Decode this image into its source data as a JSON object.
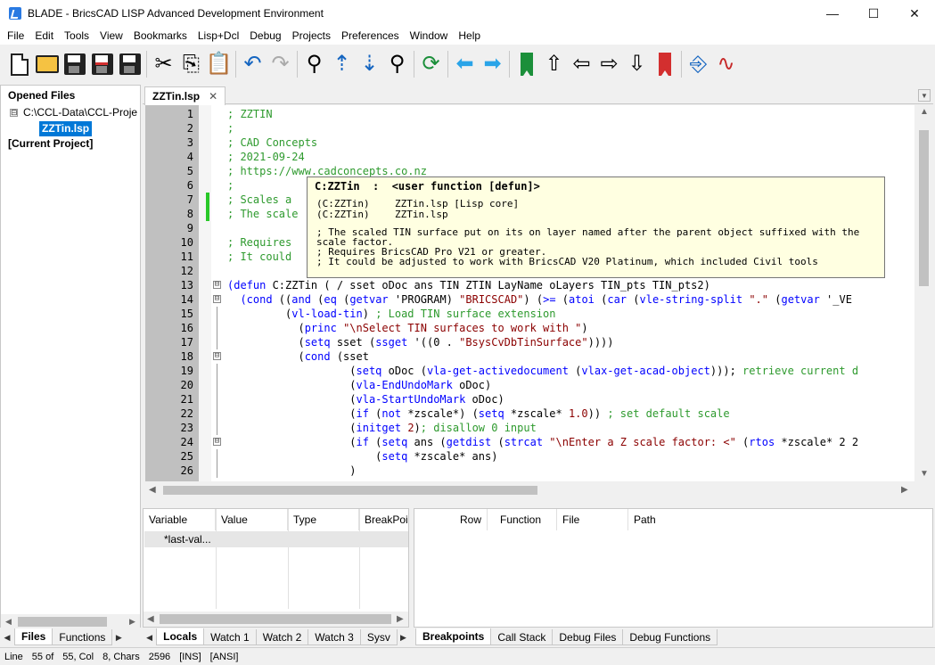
{
  "window": {
    "title": "BLADE - BricsCAD LISP Advanced Development Environment",
    "controls": [
      "—",
      "☐",
      "✕"
    ]
  },
  "menu": [
    "File",
    "Edit",
    "Tools",
    "View",
    "Bookmarks",
    "Lisp+Dcl",
    "Debug",
    "Projects",
    "Preferences",
    "Window",
    "Help"
  ],
  "toolbar_icons": [
    "new-file",
    "open-folder",
    "save",
    "save-as",
    "save-all",
    "cut",
    "copy",
    "paste",
    "undo",
    "redo",
    "find",
    "find-next",
    "find-previous",
    "replace",
    "refresh",
    "back",
    "forward",
    "add-bookmark",
    "arrow-up",
    "arrow-left",
    "arrow-right",
    "arrow-down",
    "remove-bookmark",
    "load",
    "trace"
  ],
  "files_panel": {
    "title": "Opened Files",
    "root_toggle": "⊟",
    "root_path": "C:\\CCL-Data\\CCL-Proje",
    "file": "ZZTin.lsp",
    "current_project": "[Current Project]",
    "tabs": [
      "Files",
      "Functions"
    ]
  },
  "editor": {
    "tab_label": "ZZTin.lsp",
    "tab_close": "✕",
    "lines": [
      {
        "n": "1",
        "html": "<span class=\"c\">; ZZTIN</span>"
      },
      {
        "n": "2",
        "html": "<span class=\"c\">;</span>"
      },
      {
        "n": "3",
        "html": "<span class=\"c\">; CAD Concepts</span>"
      },
      {
        "n": "4",
        "html": "<span class=\"c\">; 2021-09-24</span>"
      },
      {
        "n": "5",
        "html": "<span class=\"c\">; https://www.cadconcepts.co.nz</span>"
      },
      {
        "n": "6",
        "html": "<span class=\"c\">;</span>"
      },
      {
        "n": "7",
        "html": "<span class=\"c\">; Scales a </span>"
      },
      {
        "n": "8",
        "html": "<span class=\"c\">; The scale                                                                             sca</span>"
      },
      {
        "n": "9",
        "html": ""
      },
      {
        "n": "10",
        "html": "<span class=\"c\">; Requires </span>"
      },
      {
        "n": "11",
        "html": "<span class=\"c\">; It could </span>"
      },
      {
        "n": "12",
        "html": ""
      },
      {
        "n": "13",
        "fold": "⊟",
        "html": "<span class=\"k\">(defun</span> C:ZZTin ( / sset oDoc ans TIN ZTIN LayName oLayers TIN_pts TIN_pts2)"
      },
      {
        "n": "14",
        "fold": "⊟",
        "html": "  <span class=\"k\">(cond</span> ((<span class=\"k\">and</span> (<span class=\"k\">eq</span> (<span class=\"k\">getvar</span> 'PROGRAM) <span class=\"s\">\"BRICSCAD\"</span>) (<span class=\"k\">&gt;=</span> (<span class=\"k\">atoi</span> (<span class=\"k\">car</span> (<span class=\"k\">vle-string-split</span> <span class=\"s\">\".\"</span> (<span class=\"k\">getvar</span> '_VE"
      },
      {
        "n": "15",
        "html": "         (<span class=\"k\">vl-load-tin</span>) <span class=\"c\">; Load TIN surface extension</span>"
      },
      {
        "n": "16",
        "html": "           (<span class=\"k\">princ</span> <span class=\"s\">\"\\nSelect TIN surfaces to work with \"</span>)"
      },
      {
        "n": "17",
        "html": "           (<span class=\"k\">setq</span> sset (<span class=\"k\">ssget</span> '((0 . <span class=\"s\">\"BsysCvDbTinSurface\"</span>))))"
      },
      {
        "n": "18",
        "fold": "⊟",
        "html": "           (<span class=\"k\">cond</span> (sset"
      },
      {
        "n": "19",
        "html": "                   (<span class=\"k\">setq</span> oDoc (<span class=\"k\">vla-get-activedocument</span> (<span class=\"k\">vlax-get-acad-object</span>))); <span class=\"c\">retrieve current d</span>"
      },
      {
        "n": "20",
        "html": "                   (<span class=\"k\">vla-EndUndoMark</span> oDoc)"
      },
      {
        "n": "21",
        "html": "                   (<span class=\"k\">vla-StartUndoMark</span> oDoc)"
      },
      {
        "n": "22",
        "html": "                   (<span class=\"k\">if</span> (<span class=\"k\">not</span> *zscale*) (<span class=\"k\">setq</span> *zscale* <span class=\"n\">1.0</span>)) <span class=\"c\">; set default scale</span>"
      },
      {
        "n": "23",
        "html": "                   (<span class=\"k\">initget</span> <span class=\"n\">2</span>)<span class=\"c\">; disallow 0 input</span>"
      },
      {
        "n": "24",
        "fold": "⊟",
        "html": "                   (<span class=\"k\">if</span> (<span class=\"k\">setq</span> ans (<span class=\"k\">getdist</span> (<span class=\"k\">strcat</span> <span class=\"s\">\"\\nEnter a Z scale factor: &lt;\"</span> (<span class=\"k\">rtos</span> *zscale* 2 2"
      },
      {
        "n": "25",
        "html": "                       (<span class=\"k\">setq</span> *zscale* ans)"
      },
      {
        "n": "26",
        "html": "                   )"
      }
    ]
  },
  "tooltip": {
    "title": "C:ZZTin  :  <user function [defun]>",
    "definitions": [
      {
        "name": "(C:ZZTin)",
        "file": "ZZTin.lsp [Lisp core]"
      },
      {
        "name": "(C:ZZTin)",
        "file": "ZZTin.lsp"
      }
    ],
    "description": [
      "; The scaled TIN surface put on its on layer named after the parent object suffixed with the scale factor.",
      "; Requires BricsCAD Pro V21 or greater.",
      "; It could be adjusted to work with BricsCAD V20 Platinum, which included Civil tools"
    ]
  },
  "variables_panel": {
    "columns": [
      "Variable",
      "Value",
      "Type",
      "BreakPoint"
    ],
    "row": "*last-val...",
    "tabs": [
      "Locals",
      "Watch 1",
      "Watch 2",
      "Watch 3",
      "Sysv"
    ]
  },
  "breakpoints_panel": {
    "columns": [
      "Row",
      "Function",
      "File",
      "Path"
    ],
    "tabs": [
      "Breakpoints",
      "Call Stack",
      "Debug Files",
      "Debug Functions"
    ]
  },
  "status": {
    "line_label": "Line",
    "line_value": "55 of",
    "pos": "55, Col",
    "col_chars": "8, Chars",
    "chars": "2596",
    "mode": "[INS]",
    "encoding": "[ANSI]"
  }
}
